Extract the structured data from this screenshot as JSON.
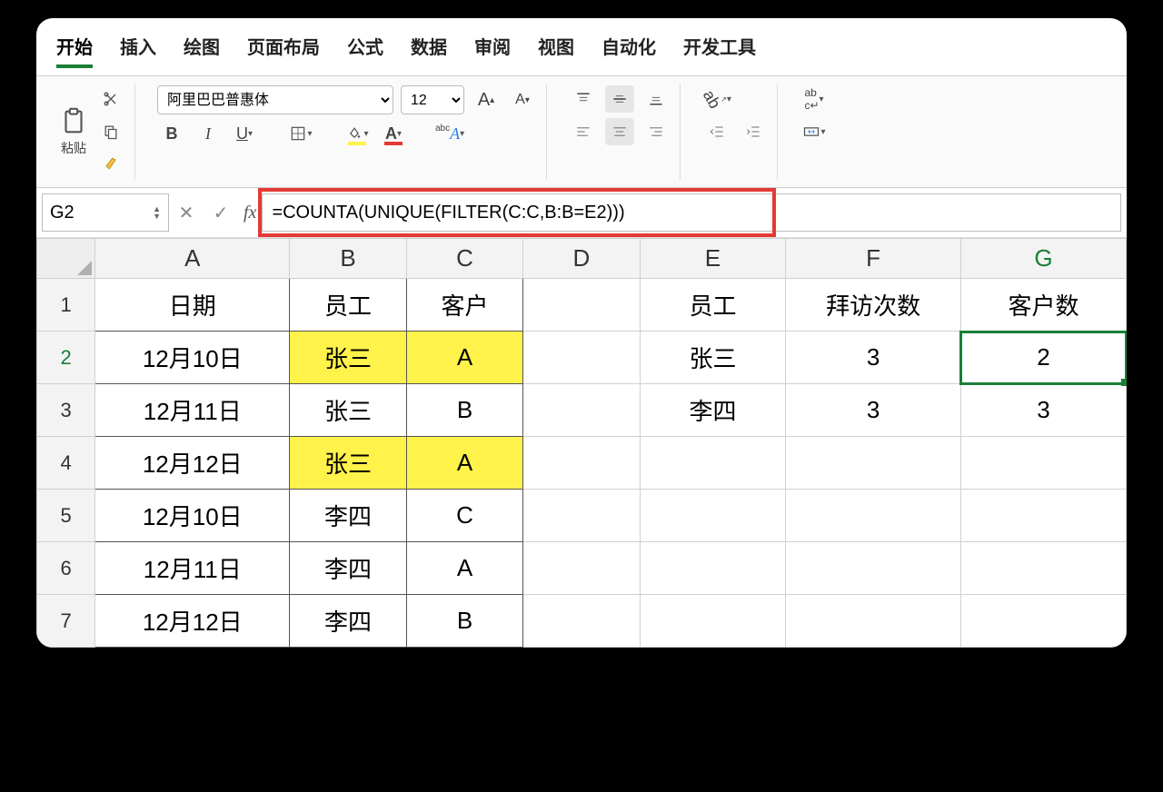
{
  "tabs": [
    "开始",
    "插入",
    "绘图",
    "页面布局",
    "公式",
    "数据",
    "审阅",
    "视图",
    "自动化",
    "开发工具"
  ],
  "clipboard": {
    "paste": "粘贴"
  },
  "font": {
    "family": "阿里巴巴普惠体",
    "size": "12"
  },
  "namebox": "G2",
  "formula": "=COUNTA(UNIQUE(FILTER(C:C,B:B=E2)))",
  "columns": [
    "A",
    "B",
    "C",
    "D",
    "E",
    "F",
    "G"
  ],
  "headers": {
    "A": "日期",
    "B": "员工",
    "C": "客户",
    "E": "员工",
    "F": "拜访次数",
    "G": "客户数"
  },
  "rows": [
    {
      "n": "1",
      "A": "日期",
      "B": "员工",
      "C": "客户",
      "D": "",
      "E": "员工",
      "F": "拜访次数",
      "G": "客户数",
      "head": true
    },
    {
      "n": "2",
      "A": "12月10日",
      "B": "张三",
      "C": "A",
      "D": "",
      "E": "张三",
      "F": "3",
      "G": "2",
      "hlBC": true
    },
    {
      "n": "3",
      "A": "12月11日",
      "B": "张三",
      "C": "B",
      "D": "",
      "E": "李四",
      "F": "3",
      "G": "3"
    },
    {
      "n": "4",
      "A": "12月12日",
      "B": "张三",
      "C": "A",
      "D": "",
      "E": "",
      "F": "",
      "G": "",
      "hlBC": true
    },
    {
      "n": "5",
      "A": "12月10日",
      "B": "李四",
      "C": "C",
      "D": "",
      "E": "",
      "F": "",
      "G": ""
    },
    {
      "n": "6",
      "A": "12月11日",
      "B": "李四",
      "C": "A",
      "D": "",
      "E": "",
      "F": "",
      "G": ""
    },
    {
      "n": "7",
      "A": "12月12日",
      "B": "李四",
      "C": "B",
      "D": "",
      "E": "",
      "F": "",
      "G": ""
    }
  ],
  "chart_data": {
    "type": "table",
    "left_table": {
      "columns": [
        "日期",
        "员工",
        "客户"
      ],
      "rows": [
        [
          "12月10日",
          "张三",
          "A"
        ],
        [
          "12月11日",
          "张三",
          "B"
        ],
        [
          "12月12日",
          "张三",
          "A"
        ],
        [
          "12月10日",
          "李四",
          "C"
        ],
        [
          "12月11日",
          "李四",
          "A"
        ],
        [
          "12月12日",
          "李四",
          "B"
        ]
      ]
    },
    "right_table": {
      "columns": [
        "员工",
        "拜访次数",
        "客户数"
      ],
      "rows": [
        [
          "张三",
          3,
          2
        ],
        [
          "李四",
          3,
          3
        ]
      ]
    }
  }
}
